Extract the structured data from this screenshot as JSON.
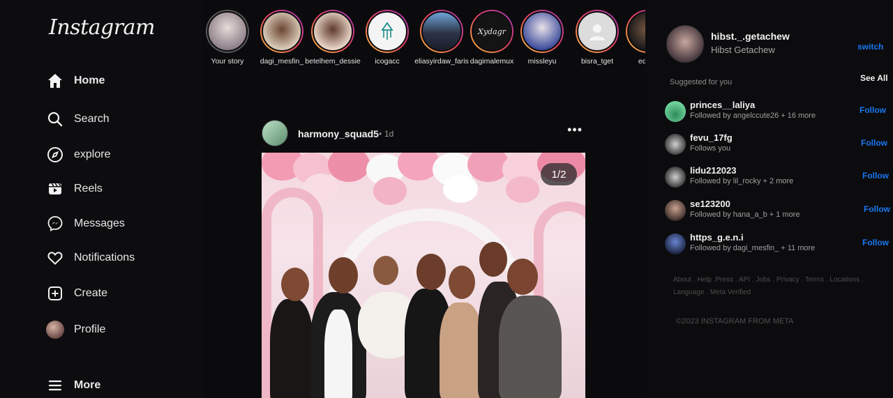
{
  "app": {
    "logo": "Instagram"
  },
  "sidebar": {
    "items": [
      {
        "label": "Home",
        "icon": "home-icon"
      },
      {
        "label": "Search",
        "icon": "search-icon"
      },
      {
        "label": "explore",
        "icon": "compass-icon"
      },
      {
        "label": "Reels",
        "icon": "reels-icon"
      },
      {
        "label": "Messages",
        "icon": "messenger-icon"
      },
      {
        "label": "Notifications",
        "icon": "heart-icon"
      },
      {
        "label": "Create",
        "icon": "plus-square-icon"
      },
      {
        "label": "Profile",
        "icon": "avatar"
      },
      {
        "label": "More",
        "icon": "menu-icon"
      }
    ]
  },
  "stories": [
    {
      "name": "Your story"
    },
    {
      "name": "dagi_mesfin_"
    },
    {
      "name": "betelhem_dessie"
    },
    {
      "name": "icogacc"
    },
    {
      "name": "eliasyirdaw_faris"
    },
    {
      "name": "dagimalemux"
    },
    {
      "name": "missleyu"
    },
    {
      "name": "bisra_tget"
    },
    {
      "name": "edom"
    }
  ],
  "post": {
    "username": "harmony_squad5",
    "separator": "•",
    "time": "1d",
    "more": "•••",
    "counter": "1/2"
  },
  "account": {
    "username": "hibst._.getachew",
    "full_name": "Hibst Getachew",
    "switch_label": "switch"
  },
  "suggestions": {
    "title": "Suggested for you",
    "see_all": "See All",
    "follow_label": "Follow",
    "items": [
      {
        "username": "princes__laliya",
        "subtitle": "Followed by angelccute26 + 16 more"
      },
      {
        "username": "fevu_17fg",
        "subtitle": "Follows you"
      },
      {
        "username": "lidu212023",
        "subtitle": "Followed by lil_rocky + 2 more"
      },
      {
        "username": "se123200",
        "subtitle": "Followed by hana_a_b + 1 more"
      },
      {
        "username": "https_g.e.n.i",
        "subtitle": "Followed by dagi_mesfin_ + 11 more"
      }
    ]
  },
  "footer": {
    "links": "About . Help .Press . API . Jobs . Privacy . Terms . Locations . Language . Meta Verified",
    "copyright": "©2023 INSTAGRAM FROM META"
  },
  "colors": {
    "accent": "#1877f2",
    "background": "#0b0b0d"
  }
}
